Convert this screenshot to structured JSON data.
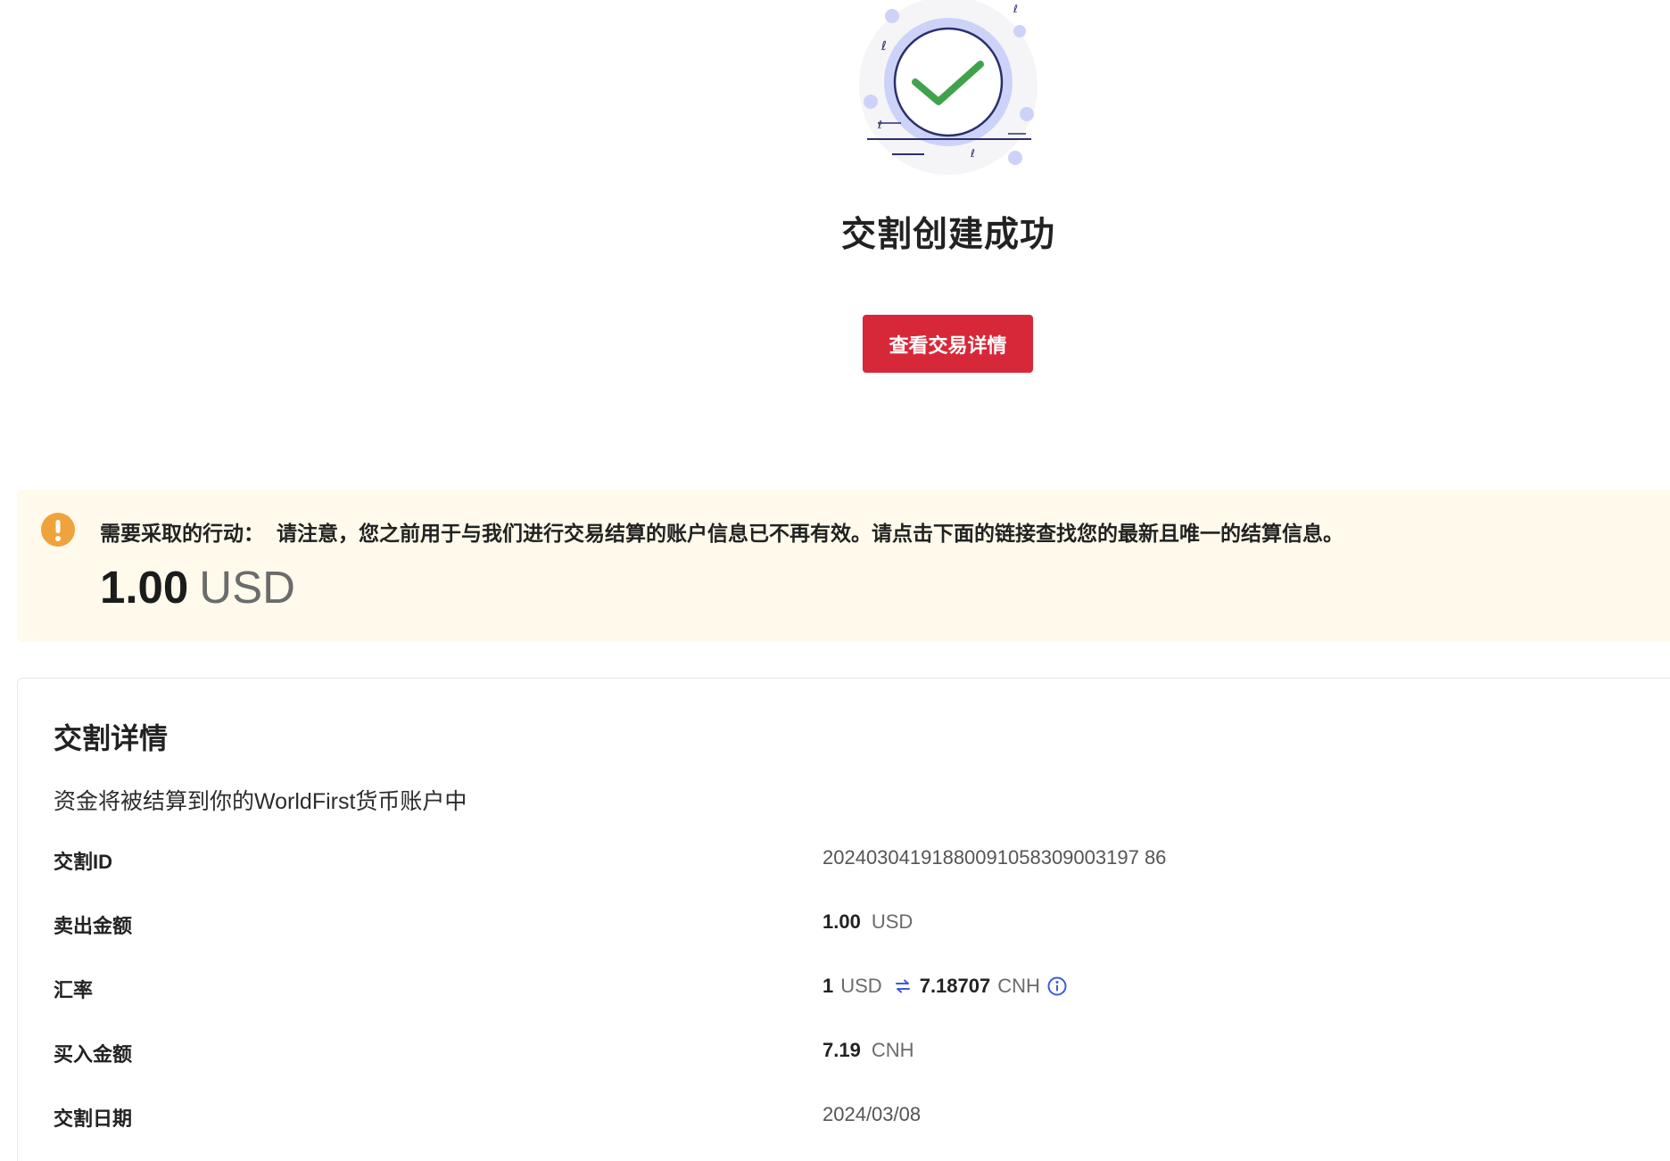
{
  "hero": {
    "title": "交割创建成功",
    "button_label": "查看交易详情",
    "icon": "success-check-illustration"
  },
  "alert": {
    "icon": "exclamation-icon",
    "label": "需要采取的行动：",
    "message": "请注意，您之前用于与我们进行交易结算的账户信息已不再有效。请点击下面的链接查找您的最新且唯一的结算信息。",
    "amount_value": "1.00",
    "amount_currency": "USD"
  },
  "details": {
    "title": "交割详情",
    "subtitle": "资金将被结算到你的WorldFirst货币账户中",
    "rows": {
      "settlement_id": {
        "label": "交割ID",
        "value": "20240304191880091058309003197 86"
      },
      "sell_amount": {
        "label": "卖出金额",
        "value": "1.00",
        "currency": "USD"
      },
      "rate": {
        "label": "汇率",
        "from_value": "1",
        "from_currency": "USD",
        "to_value": "7.18707",
        "to_currency": "CNH",
        "swap_icon": "swap-arrows-icon",
        "info_icon": "info-icon"
      },
      "buy_amount": {
        "label": "买入金额",
        "value": "7.19",
        "currency": "CNH"
      },
      "date": {
        "label": "交割日期",
        "value": "2024/03/08"
      }
    }
  },
  "colors": {
    "primary": "#d7283a",
    "alert_bg": "#fffaeb",
    "alert_icon": "#f0a23c",
    "success_green": "#3fa34d",
    "illustration_blue": "#c9cff7",
    "link_blue": "#3b5bdb"
  }
}
